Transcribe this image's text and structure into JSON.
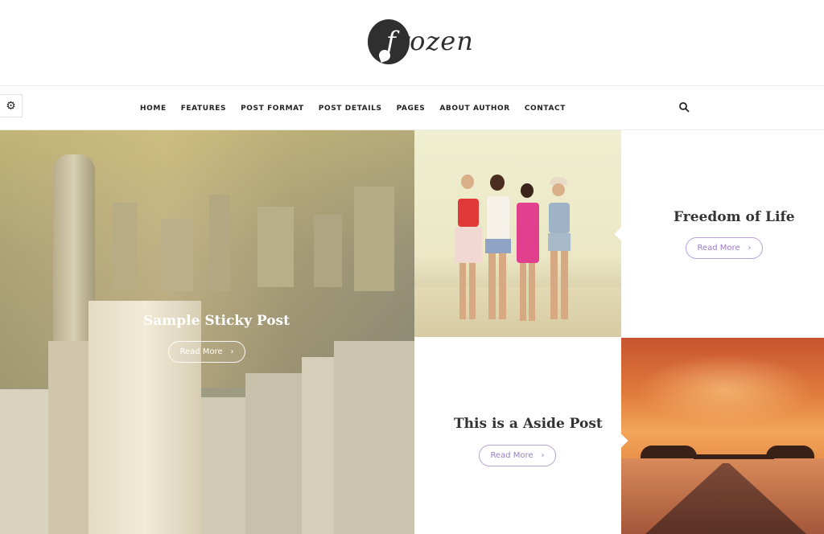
{
  "header": {
    "logo_text": "frozen",
    "logo_first": "f",
    "logo_rest": "rozen"
  },
  "nav": {
    "items": [
      {
        "label": "HOME"
      },
      {
        "label": "FEATURES"
      },
      {
        "label": "POST FORMAT"
      },
      {
        "label": "POST DETAILS"
      },
      {
        "label": "PAGES"
      },
      {
        "label": "ABOUT AUTHOR"
      },
      {
        "label": "CONTACT"
      }
    ],
    "settings_icon": "gear-icon",
    "search_icon": "search-icon"
  },
  "posts": {
    "sticky": {
      "title": "Sample Sticky Post",
      "read_more": "Read More",
      "arrow": "›"
    },
    "freedom": {
      "title": "Freedom of Life",
      "read_more": "Read More",
      "arrow": "›"
    },
    "aside": {
      "title": "This is a Aside Post",
      "read_more": "Read More",
      "arrow": "›"
    }
  },
  "colors": {
    "accent": "#9a7cc7",
    "accent_border": "#b7a0d6",
    "text_dark": "#333333"
  }
}
